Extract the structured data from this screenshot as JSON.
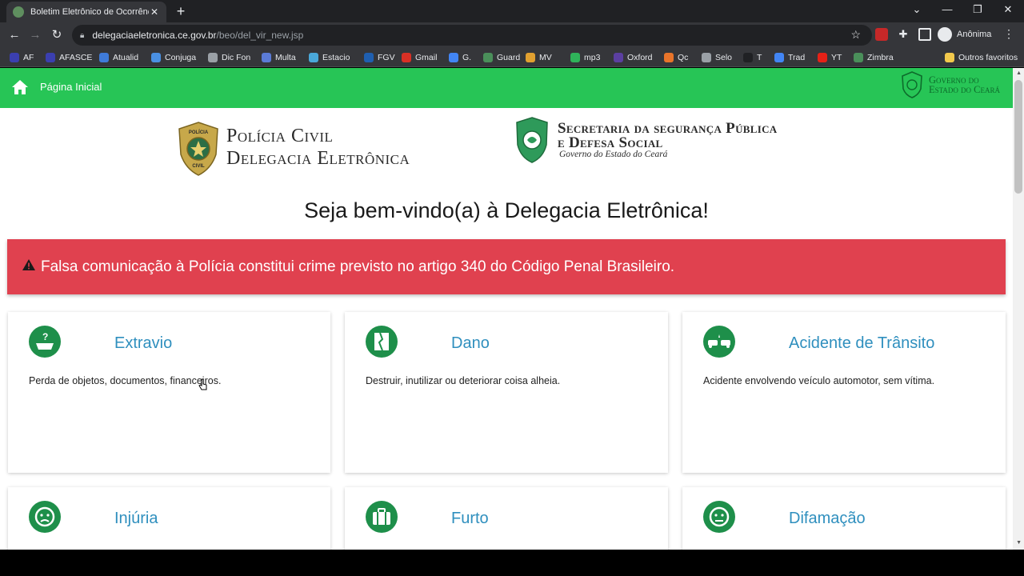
{
  "browser": {
    "tab_title": "Boletim Eletrônico de Ocorrência",
    "url_host": "delegaciaeletronica.ce.gov.br",
    "url_path": "/beo/del_vir_new.jsp",
    "profile_name": "Anônima",
    "bookmarks": [
      {
        "label": "AF",
        "color": "#3b3fb0"
      },
      {
        "label": "AFASCE",
        "color": "#3b3fb0"
      },
      {
        "label": "Atualid",
        "color": "#3f7bd9"
      },
      {
        "label": "Conjuga",
        "color": "#4a90e2"
      },
      {
        "label": "Dic Fon",
        "color": "#9aa0a6"
      },
      {
        "label": "Multa",
        "color": "#5b7bd6"
      },
      {
        "label": "Estacio",
        "color": "#4aa8d9"
      },
      {
        "label": "FGV",
        "color": "#1f5fb0"
      },
      {
        "label": "Gmail",
        "color": "#d93025"
      },
      {
        "label": "G.",
        "color": "#4285f4"
      },
      {
        "label": "Guard",
        "color": "#4a8f5a"
      },
      {
        "label": "MV",
        "color": "#e0a030"
      },
      {
        "label": "mp3",
        "color": "#2fb35a"
      },
      {
        "label": "Oxford",
        "color": "#5b3fa0"
      },
      {
        "label": "Qc",
        "color": "#e8742a"
      },
      {
        "label": "Selo",
        "color": "#9aa0a6"
      },
      {
        "label": "T",
        "color": "#202124"
      },
      {
        "label": "Trad",
        "color": "#4285f4"
      },
      {
        "label": "YT",
        "color": "#e62117"
      },
      {
        "label": "Zimbra",
        "color": "#4a8f5a"
      }
    ],
    "other_bookmarks": "Outros favoritos"
  },
  "header": {
    "home_label": "Página Inicial",
    "gov_text_line1": "Governo do",
    "gov_text_line2": "Estado do Ceará"
  },
  "logos": {
    "policia_line1": "Polícia Civil",
    "policia_line2": "Delegacia Eletrônica",
    "badge_text_top": "POLÍCIA",
    "badge_text_bottom": "CIVIL",
    "secretaria_line1": "Secretaria da segurança Pública",
    "secretaria_line2": "e Defesa Social",
    "secretaria_sub": "Governo do Estado do Ceará"
  },
  "main": {
    "welcome": "Seja bem-vindo(a) à Delegacia Eletrônica!",
    "alert": "Falsa comunicação à Polícia constitui crime previsto no artigo 340 do Código Penal Brasileiro.",
    "cards": [
      {
        "title": "Extravio",
        "desc": "Perda de objetos, documentos, financeiros."
      },
      {
        "title": "Dano",
        "desc": "Destruir, inutilizar ou deteriorar coisa alheia."
      },
      {
        "title": "Acidente de Trânsito",
        "desc": "Acidente envolvendo veículo automotor, sem vítima."
      },
      {
        "title": "Injúria",
        "desc": ""
      },
      {
        "title": "Furto",
        "desc": ""
      },
      {
        "title": "Difamação",
        "desc": ""
      }
    ]
  },
  "colors": {
    "header_green": "#27c556",
    "alert_red": "#e0414f",
    "card_title_blue": "#2f8fbe",
    "icon_green": "#1e8f4a"
  }
}
